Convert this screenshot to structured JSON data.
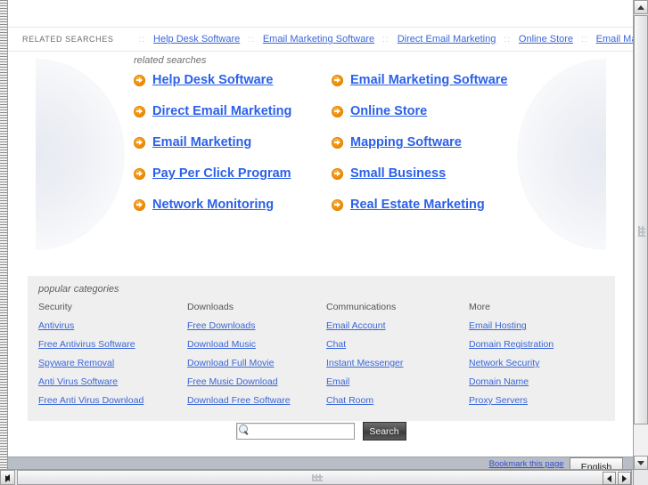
{
  "topstrip": {
    "label": "RELATED SEARCHES",
    "separator": "::",
    "links": [
      "Help Desk Software",
      "Email Marketing Software",
      "Direct Email Marketing",
      "Online Store",
      "Email Marketing"
    ]
  },
  "related_searches": {
    "caption": "related searches",
    "items": [
      "Help Desk Software",
      "Email Marketing Software",
      "Direct Email Marketing",
      "Online Store",
      "Email Marketing",
      "Mapping Software",
      "Pay Per Click Program",
      "Small Business",
      "Network Monitoring",
      "Real Estate Marketing"
    ]
  },
  "popular_categories": {
    "caption": "popular categories",
    "columns": [
      {
        "heading": "Security",
        "links": [
          "Antivirus",
          "Free Antivirus Software",
          "Spyware Removal",
          "Anti Virus Software",
          "Free Anti Virus Download"
        ]
      },
      {
        "heading": "Downloads",
        "links": [
          "Free Downloads",
          "Download Music",
          "Download Full Movie",
          "Free Music Download",
          "Download Free Software"
        ]
      },
      {
        "heading": "Communications",
        "links": [
          "Email Account",
          "Chat",
          "Instant Messenger",
          "Email",
          "Chat Room"
        ]
      },
      {
        "heading": "More",
        "links": [
          "Email Hosting",
          "Domain Registration",
          "Network Security",
          "Domain Name",
          "Proxy Servers"
        ]
      }
    ]
  },
  "search": {
    "value": "",
    "placeholder": "",
    "button_label": "Search",
    "icon": "magnifier-icon"
  },
  "bottom_bar": {
    "bookmark_label": "Bookmark this page",
    "separator": "|",
    "language_value": "English"
  },
  "colors": {
    "link_blue": "#2b61e8",
    "small_link_blue": "#3a66d8",
    "arrow_orange": "#f08a00",
    "panel_gray": "#efefef",
    "bottom_bar": "#b9bdc6"
  }
}
